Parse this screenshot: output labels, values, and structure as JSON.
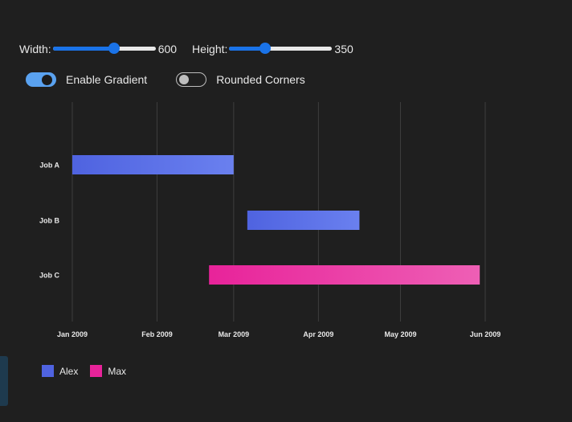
{
  "controls": {
    "width_label": "Width:",
    "width_value": "600",
    "width_fraction": 0.6,
    "height_label": "Height:",
    "height_value": "350",
    "height_fraction": 0.35,
    "gradient_label": "Enable Gradient",
    "gradient_on": true,
    "rounded_label": "Rounded Corners",
    "rounded_on": false
  },
  "colors": {
    "background": "#1f1f1f",
    "alex": "#4f63e0",
    "max": "#e8239a",
    "accent": "#1a73e8"
  },
  "chart_data": {
    "type": "gantt",
    "categories": [
      "Job A",
      "Job B",
      "Job C"
    ],
    "x_ticks": [
      "Jan 2009",
      "Feb 2009",
      "Mar 2009",
      "Apr 2009",
      "May 2009",
      "Jun 2009"
    ],
    "xlim": [
      "2009-01-01",
      "2009-06-01"
    ],
    "grid": "vertical",
    "series": [
      {
        "name": "Alex",
        "color": "#4f63e0",
        "color_end": "#6a80ef",
        "tasks": [
          {
            "category": "Job A",
            "start": "2009-01-01",
            "end": "2009-03-01"
          },
          {
            "category": "Job B",
            "start": "2009-03-06",
            "end": "2009-04-16"
          }
        ]
      },
      {
        "name": "Max",
        "color": "#e8239a",
        "color_end": "#ee5fb5",
        "tasks": [
          {
            "category": "Job C",
            "start": "2009-02-20",
            "end": "2009-05-30"
          }
        ]
      }
    ],
    "legend": "bottom-left"
  }
}
